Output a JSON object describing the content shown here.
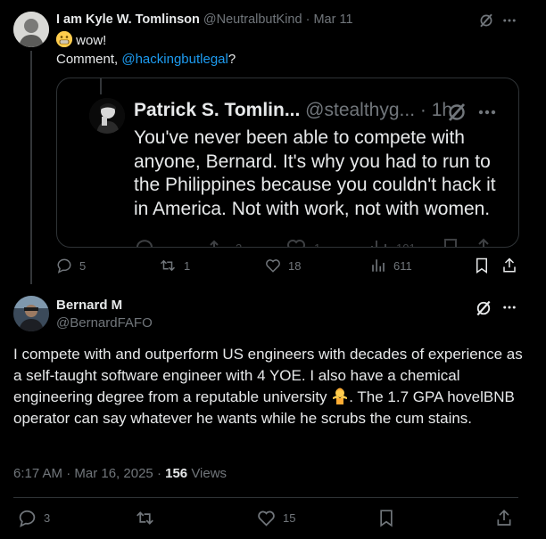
{
  "tweet1": {
    "name": "I am Kyle W. Tomlinson",
    "handle": "@NeutralbutKind",
    "dot": "·",
    "date": "Mar 11",
    "line1": "wow!",
    "comment_prefix": "Comment,",
    "mention": "@hackingbutlegal",
    "comment_suffix": "?",
    "actions": {
      "replies": "5",
      "reposts": "1",
      "likes": "18",
      "views": "611"
    }
  },
  "quote": {
    "name": "Patrick S. Tomlin...",
    "handle": "@stealthyg...",
    "dot": "·",
    "time": "1h",
    "text": "You've never been able to compete with anyone, Bernard. It's why you had to run to the Philippines because you couldn't hack it in America. Not with work, not with women.",
    "faded_actions": {
      "reposts": "2",
      "likes": "1",
      "views": "101"
    }
  },
  "tweet2": {
    "name": "Bernard M",
    "handle": "@BernardFAFO",
    "text_before_emoji": "I compete with and outperform US engineers with decades of experience as a self-taught software engineer with 4 YOE. I also have a chemical engineering degree from a reputable university ",
    "text_after_emoji": ". The 1.7 GPA hovelBNB operator can say whatever he wants while he scrubs the cum stains.",
    "timestamp": "6:17 AM · Mar 16, 2025",
    "dot": "·",
    "views_count": "156",
    "views_label": "Views",
    "actions": {
      "replies": "3",
      "likes": "15"
    }
  },
  "colors": {
    "accent": "#1d9bf0",
    "muted": "#71767b",
    "text": "#e7e9ea",
    "border": "#2f3336"
  }
}
